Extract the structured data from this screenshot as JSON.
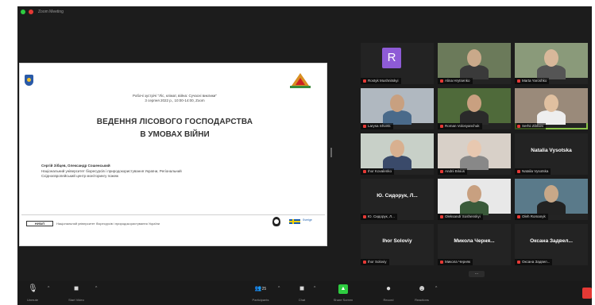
{
  "window": {
    "title": "Zoom Meeting"
  },
  "slide": {
    "subtitle_line1": "Робочі зустрічі \"Ліс, клімат, війна: Сучасні виклики\"",
    "subtitle_line2": "3 серпня 2022 р., 10:00-14:00, Zoom",
    "title_line1": "ВЕДЕННЯ ЛІСОВОГО ГОСПОДАРСТВА",
    "title_line2": "В УМОВАХ ВІЙНИ",
    "authors": "Сергій Зібцев, Олександр Сошенський",
    "org_line1": "Національний університет біоресурсів і природокористування України, Регіональний",
    "org_line2": "Східноєвропейський центр моніторингу пожеж",
    "footer_logo": "НУБіП",
    "footer_text": "Національний університет біоресурсів і природокористування України",
    "sweden_text": "Sverige"
  },
  "participants": [
    {
      "name": "Rostyk Mushnitskyi",
      "label": "R",
      "type": "avatar"
    },
    {
      "name": "Alina Hrytsenko",
      "type": "video"
    },
    {
      "name": "Marta Yaroshko",
      "type": "video"
    },
    {
      "name": "Larysa Shvets",
      "type": "video"
    },
    {
      "name": "Roman Volosyanchuk",
      "type": "video"
    },
    {
      "name": "Serhii Zibtsev",
      "type": "video",
      "active": true
    },
    {
      "name": "Ihor Kovalenko",
      "type": "video"
    },
    {
      "name": "Andrii Bilous",
      "type": "video"
    },
    {
      "name": "Natalia Vysotska",
      "type": "name",
      "big": "Natalia Vysotska"
    },
    {
      "name": "Ю. Сидорук, Л...",
      "type": "name",
      "big": "Ю. Сидорук, Л..."
    },
    {
      "name": "Oleksandr Soshenskyi",
      "type": "video"
    },
    {
      "name": "Oleh Romanyk",
      "type": "video"
    },
    {
      "name": "Ihor Soloviy",
      "type": "name",
      "big": "Ihor Soloviy"
    },
    {
      "name": "Микола Черняк",
      "type": "name",
      "big": "Микола Черня..."
    },
    {
      "name": "Оксана Задвел...",
      "type": "name",
      "big": "Оксана Задвел..."
    }
  ],
  "more_button": "...",
  "toolbar": {
    "unmute": "Unmute",
    "start_video": "Start Video",
    "participants": "Participants",
    "participants_count": "25",
    "chat": "Chat",
    "share_screen": "Share Screen",
    "record": "Record",
    "reactions": "Reactions"
  },
  "colors": {
    "app_bg": "#1c1c1c",
    "active_speaker": "#8bc34a",
    "avatar_bg": "#8e5bd6",
    "share_green": "#2ecc40",
    "end_red": "#e53935"
  }
}
